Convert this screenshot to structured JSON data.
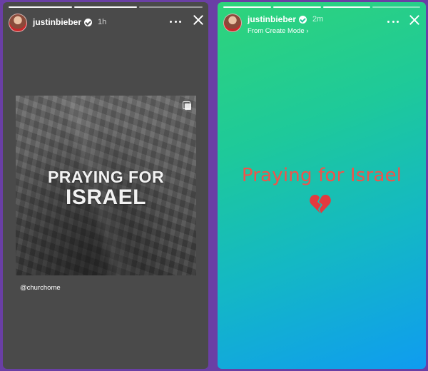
{
  "stories": [
    {
      "username": "justinbieber",
      "time": "1h",
      "post": {
        "title_line1": "PRAYING FOR",
        "title_line2": "ISRAEL"
      },
      "mention": "@churchome"
    },
    {
      "username": "justinbieber",
      "time": "2m",
      "subtitle": "From Create Mode ›",
      "text": "Praying for Israel",
      "emoji": "broken-heart-icon"
    }
  ],
  "colors": {
    "frame_purple": "#6a3fa5",
    "story_text": "#f0534a",
    "gradient_top": "#2fd47a",
    "gradient_bottom": "#0f9cf0"
  }
}
